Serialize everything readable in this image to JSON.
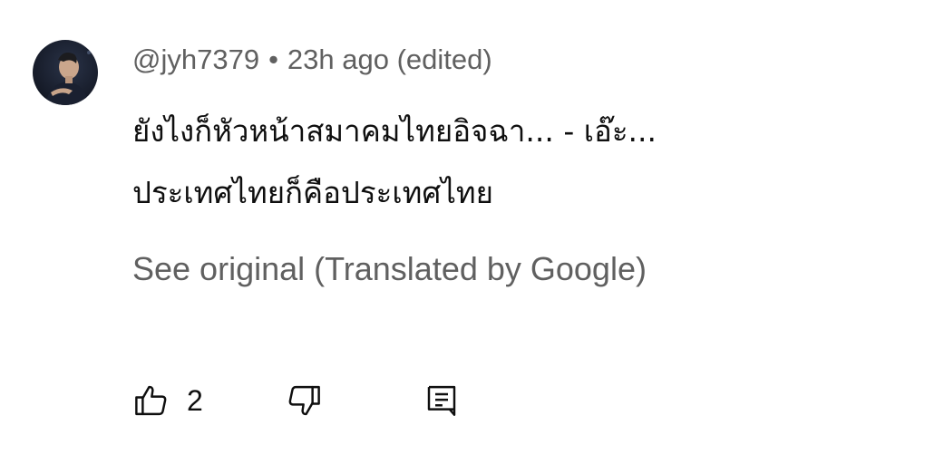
{
  "comment": {
    "author": "@jyh7379",
    "separator": "•",
    "timestamp": "23h ago (edited)",
    "text_lines": [
      "ยังไงก็หัวหน้าสมาคมไทยอิจฉา... - เอ๊ะ...",
      "ประเทศไทยก็คือประเทศไทย"
    ],
    "translate_label": "See original (Translated by Google)",
    "like_count": "2"
  },
  "icons": {
    "like": "thumbs-up-icon",
    "dislike": "thumbs-down-icon",
    "reply": "comment-icon"
  },
  "colors": {
    "text_primary": "#0f0f0f",
    "text_secondary": "#606060",
    "background": "#ffffff"
  }
}
